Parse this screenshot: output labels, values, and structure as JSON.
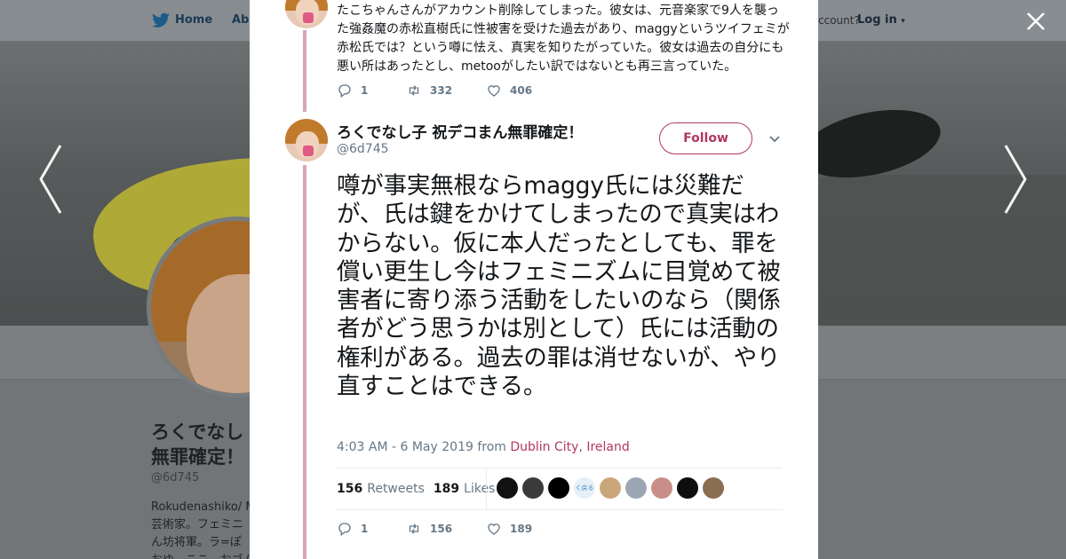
{
  "nav": {
    "home": "Home",
    "about": "Abo",
    "have_account": "ccount?",
    "login": "Log in"
  },
  "background_profile": {
    "name_line1": "ろくでなし",
    "name_line2": "無罪確定！",
    "handle": "@6d745",
    "bio_line1": "Rokudenashiko/ M",
    "bio_line2": "芸術家。フェミニ",
    "bio_line3": "ん坊将軍。ラ=ぽ",
    "bio_line4": "おゆ、ここ、おゴム"
  },
  "previous_tweet": {
    "text": "たこちゃんさんがアカウント削除してしまった。彼女は、元音楽家で9人を襲った強姦魔の赤松直樹氏に性被害を受けた過去があり、maggyというツイフェミが赤松氏では？という噂に怯え、真実を知りたがっていた。彼女は過去の自分にも悪い所はあったとし、metooがしたい訳ではないとも再三言っていた。",
    "replies": "1",
    "retweets": "332",
    "likes": "406"
  },
  "tweet": {
    "name": "ろくでなし子 祝デコまん無罪確定！",
    "handle": "@6d745",
    "follow_label": "Follow",
    "text": "噂が事実無根ならmaggy氏には災難だが、氏は鍵をかけてしまったので真実はわからない。仮に本人だったとしても、罪を償い更生し今はフェミニズムに目覚めて被害者に寄り添う活動をしたいのなら（関係者がどう思うかは別として）氏には活動の権利がある。過去の罪は消せないが、やり直すことはできる。",
    "timestamp": "4:03 AM - 6 May 2019 from ",
    "location": "Dublin City, Ireland",
    "retweet_count": "156",
    "retweets_label": "Retweets",
    "like_count": "189",
    "likes_label": "Likes",
    "replies": "1",
    "retweets": "156",
    "likes": "189",
    "liker_colors": [
      "#111111",
      "#3a3a3a",
      "#000000",
      "#e8f0f7",
      "#c9a77a",
      "#9aa7b3",
      "#c98e88",
      "#0d0d0d",
      "#8a6e52"
    ],
    "liker4_text": "く戻る"
  },
  "colors": {
    "accent": "#b0385f",
    "thread_line": "#d7a7b9",
    "muted": "#657786",
    "text": "#14171a"
  },
  "icons": [
    "twitter-bird-icon",
    "close-icon",
    "chevron-left-icon",
    "chevron-right-icon",
    "reply-icon",
    "retweet-icon",
    "heart-icon",
    "caret-down-icon"
  ]
}
